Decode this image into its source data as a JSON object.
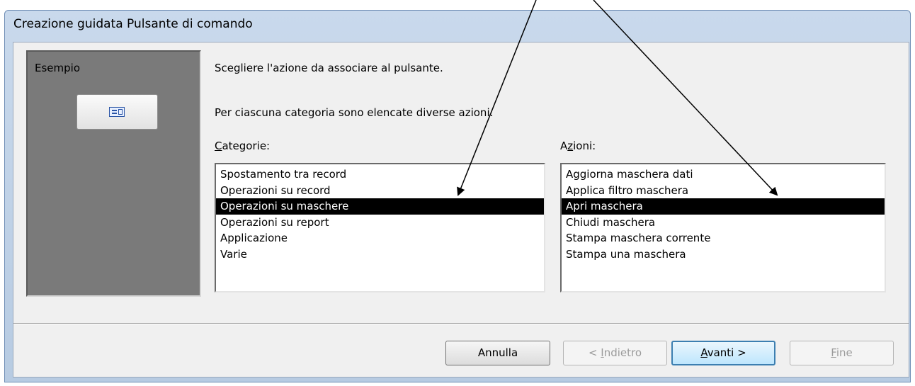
{
  "window": {
    "title": "Creazione guidata Pulsante di comando"
  },
  "example": {
    "label": "Esempio",
    "button_icon": "form-icon"
  },
  "instructions": {
    "line1": "Scegliere l'azione da associare al pulsante.",
    "line2": "Per ciascuna categoria sono elencate diverse azioni."
  },
  "categories": {
    "label_accesskey": "C",
    "label_rest": "ategorie:",
    "items": [
      "Spostamento tra record",
      "Operazioni su record",
      "Operazioni su maschere",
      "Operazioni su report",
      "Applicazione",
      "Varie"
    ],
    "selected": "Operazioni su maschere"
  },
  "actions": {
    "label_pre": "A",
    "label_accesskey": "z",
    "label_rest": "ioni:",
    "items": [
      "Aggiorna maschera dati",
      "Applica filtro maschera",
      "Apri maschera",
      "Chiudi maschera",
      "Stampa maschera corrente",
      "Stampa una maschera"
    ],
    "selected": "Apri maschera"
  },
  "buttons": {
    "cancel": "Annulla",
    "back_pre": "< ",
    "back_accesskey": "I",
    "back_rest": "ndietro",
    "next_accesskey": "A",
    "next_rest": "vanti >",
    "finish_accesskey": "F",
    "finish_rest": "ine"
  },
  "colors": {
    "selection_bg": "#000000",
    "selection_fg": "#ffffff",
    "example_panel": "#7a7a7a"
  }
}
